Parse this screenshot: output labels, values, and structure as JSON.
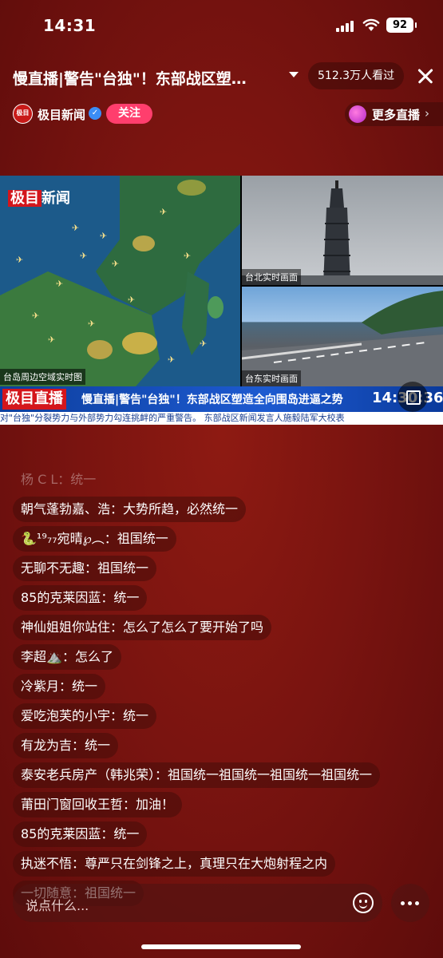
{
  "status_bar": {
    "time": "14:31",
    "battery": "92"
  },
  "header": {
    "title": "慢直播|警告\"台独\"！东部战区塑…",
    "viewers": "512.3万人看过",
    "channel_name": "极目新闻",
    "channel_logo_text": "极目",
    "follow_label": "关注",
    "more_live_label": "更多直播"
  },
  "video": {
    "brand": [
      "极目",
      "新闻"
    ],
    "map_label": "台岛周边空域实时图",
    "cam_taipei_label": "台北实时画面",
    "cam_taitung_label": "台东实时画面",
    "ticker_brand": "极目直播",
    "ticker_headline": "慢直播|警告\"台独\"！东部战区塑造全向围岛进逼之势",
    "ticker_clock": "14:30:36",
    "subticker": "对\"台独\"分裂势力与外部势力勾连挑衅的严重警告。  东部战区新闻发言人施毅陆军大校表"
  },
  "comments": [
    {
      "user": "杨 C L",
      "msg": "统一",
      "faded": true
    },
    {
      "user": "朝气蓬勃嘉、浩",
      "msg": "大势所趋，必然统一",
      "faded": false
    },
    {
      "user": "🐍¹⁹₇₇宛晴℘︵",
      "msg": "祖国统一",
      "faded": false
    },
    {
      "user": "无聊不无趣",
      "msg": "祖国统一",
      "faded": false
    },
    {
      "user": "85的克莱因蓝",
      "msg": "统一",
      "faded": false
    },
    {
      "user": "神仙姐姐你站住",
      "msg": "怎么了怎么了要开始了吗",
      "faded": false
    },
    {
      "user": "李超⛰️",
      "msg": "怎么了",
      "faded": false
    },
    {
      "user": "冷紫月",
      "msg": "统一",
      "faded": false
    },
    {
      "user": "爱吃泡芙的小宇",
      "msg": "统一",
      "faded": false
    },
    {
      "user": "有龙为吉",
      "msg": "统一",
      "faded": false
    },
    {
      "user": "泰安老兵房产（韩兆荣）",
      "msg": "祖国统一祖国统一祖国统一祖国统一",
      "faded": false
    },
    {
      "user": "莆田门窗回收王哲",
      "msg": "加油！",
      "faded": false
    },
    {
      "user": "85的克莱因蓝",
      "msg": "统一",
      "faded": false
    },
    {
      "user": "执迷不悟",
      "msg": "尊严只在剑锋之上，真理只在大炮射程之内",
      "faded": false
    },
    {
      "user": "一切随意",
      "msg": "祖国统一",
      "faded": false
    }
  ],
  "input": {
    "placeholder": "说点什么..."
  },
  "colors": {
    "background": "#7a1410",
    "follow": "#ff3e6d",
    "ticker": "#1d5ad0",
    "brand_red": "#d4161c"
  }
}
